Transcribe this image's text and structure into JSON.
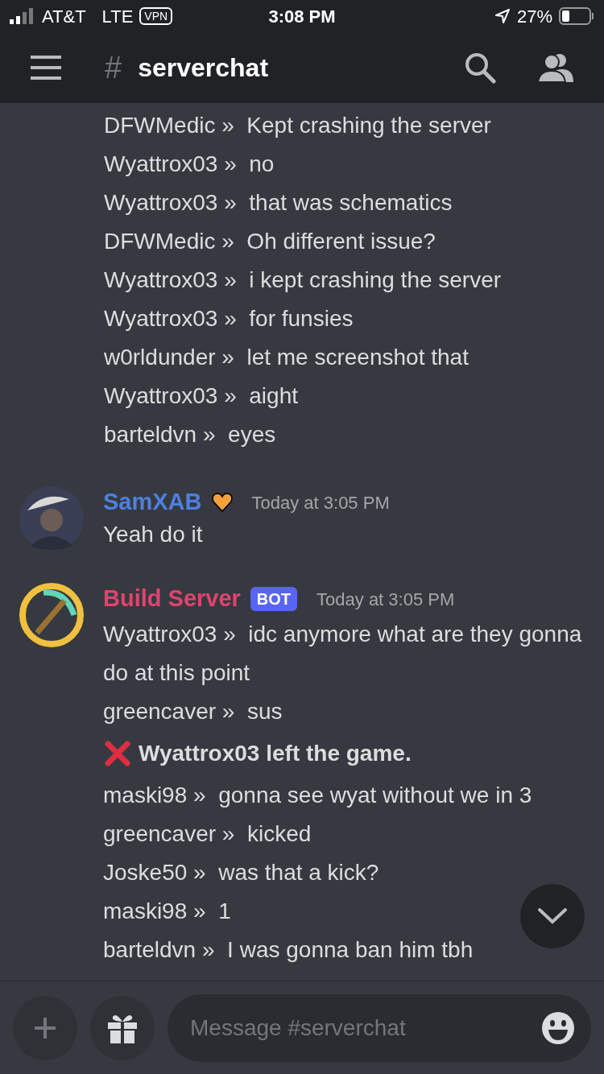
{
  "status_bar": {
    "carrier": "AT&T",
    "network": "LTE",
    "vpn": "VPN",
    "time": "3:08 PM",
    "battery": "27%"
  },
  "header": {
    "hash": "#",
    "channel": "serverchat"
  },
  "groups": [
    {
      "messages": [
        {
          "kind": "relay",
          "author": "DFWMedic »",
          "text": "Kept crashing the server"
        },
        {
          "kind": "relay",
          "author": "Wyattrox03 »",
          "text": "no"
        },
        {
          "kind": "relay",
          "author": "Wyattrox03 »",
          "text": "that was schematics"
        },
        {
          "kind": "relay",
          "author": "DFWMedic »",
          "text": "Oh different issue?"
        },
        {
          "kind": "relay",
          "author": "Wyattrox03 »",
          "text": "i kept crashing the server"
        },
        {
          "kind": "relay",
          "author": "Wyattrox03 »",
          "text": "for funsies"
        },
        {
          "kind": "relay",
          "author": "w0rldunder »",
          "text": "let me screenshot that"
        },
        {
          "kind": "relay",
          "author": "Wyattrox03 »",
          "text": "aight"
        },
        {
          "kind": "relay",
          "author": "barteldvn »",
          "text": "eyes"
        }
      ]
    },
    {
      "name": "SamXAB",
      "color": "#4f7fe0",
      "heart": true,
      "timestamp": "Today at 3:05 PM",
      "messages": [
        {
          "kind": "plain",
          "text": "Yeah do it"
        }
      ]
    },
    {
      "avatar": {
        "kind": "pickaxe"
      },
      "name": "Build Server",
      "color": "#e0436f",
      "badge": "BOT",
      "timestamp": "Today at 3:05 PM",
      "messages": [
        {
          "kind": "relay",
          "author": "Wyattrox03 »",
          "text": "idc anymore what are they gonna do at this point"
        },
        {
          "kind": "relay",
          "author": "greencaver »",
          "text": "sus"
        },
        {
          "kind": "event",
          "text": "Wyattrox03 left the game."
        },
        {
          "kind": "relay",
          "author": "maski98 »",
          "text": "gonna see wyat without we in 3"
        },
        {
          "kind": "relay",
          "author": "greencaver »",
          "text": "kicked"
        },
        {
          "kind": "relay",
          "author": "Joske50 »",
          "text": "was that a kick?"
        },
        {
          "kind": "relay",
          "author": "maski98 »",
          "text": "1"
        },
        {
          "kind": "relay",
          "author": "barteldvn »",
          "text": "I was gonna ban him tbh"
        }
      ]
    }
  ],
  "composer": {
    "placeholder": "Message #serverchat"
  }
}
